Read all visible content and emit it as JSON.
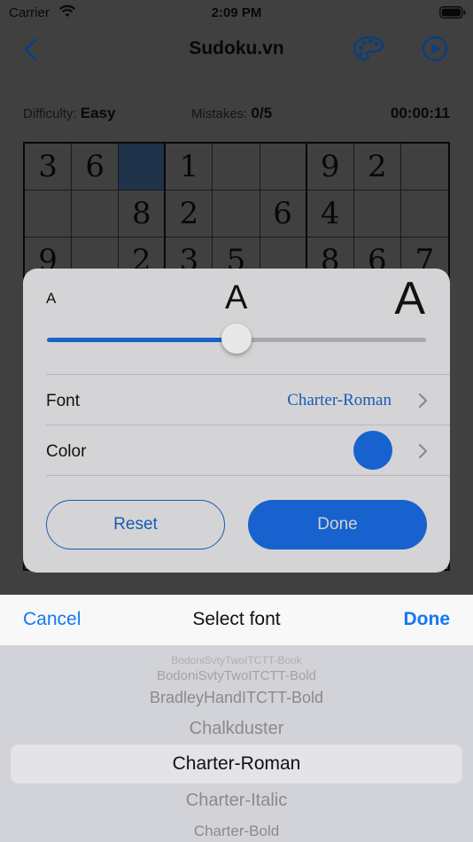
{
  "status_bar": {
    "carrier": "Carrier",
    "time": "2:09 PM"
  },
  "nav": {
    "title": "Sudoku.vn",
    "icons": [
      "chevron-left-icon",
      "palette-icon",
      "play-icon"
    ]
  },
  "info": {
    "difficulty_label": "Difficulty:",
    "difficulty_value": "Easy",
    "mistakes_label": "Mistakes:",
    "mistakes_value": "0/5",
    "timer": "00:00:11"
  },
  "grid": {
    "rows": [
      [
        "3",
        "6",
        "",
        "1",
        "",
        "",
        "9",
        "2",
        ""
      ],
      [
        "",
        "",
        "8",
        "2",
        "",
        "6",
        "4",
        "",
        ""
      ],
      [
        "9",
        "",
        "2",
        "3",
        "5",
        "",
        "8",
        "6",
        "7"
      ],
      [
        "",
        "",
        "",
        "",
        "",
        "",
        "",
        "",
        ""
      ],
      [
        "",
        "",
        "",
        "",
        "",
        "",
        "",
        "",
        ""
      ],
      [
        "",
        "",
        "",
        "",
        "",
        "",
        "",
        "",
        ""
      ],
      [
        "",
        "",
        "",
        "",
        "",
        "",
        "",
        "",
        ""
      ],
      [
        "",
        "",
        "",
        "",
        "",
        "",
        "",
        "",
        ""
      ],
      [
        "",
        "",
        "",
        "",
        "",
        "",
        "",
        "",
        ""
      ]
    ],
    "selected_cell": "row 1, column 3"
  },
  "settings_panel": {
    "size_small": "A",
    "size_medium": "A",
    "size_large": "A",
    "font_size_level": 0.5,
    "font_label": "Font",
    "font_value": "Charter-Roman",
    "color_label": "Color",
    "color_value": "#1762cf",
    "reset_label": "Reset",
    "done_label": "Done"
  },
  "font_picker": {
    "cancel_label": "Cancel",
    "title": "Select font",
    "done_label": "Done",
    "options": [
      "BodoniSvtyTwoITCTT-Book",
      "BodoniSvtyTwoITCTT-Bold",
      "BradleyHandITCTT-Bold",
      "Chalkduster",
      "Charter-Roman",
      "Charter-Italic",
      "Charter-Bold"
    ],
    "selected": "Charter-Roman"
  },
  "colors": {
    "accent": "#1478f2",
    "panel_blue": "#1762cf"
  }
}
